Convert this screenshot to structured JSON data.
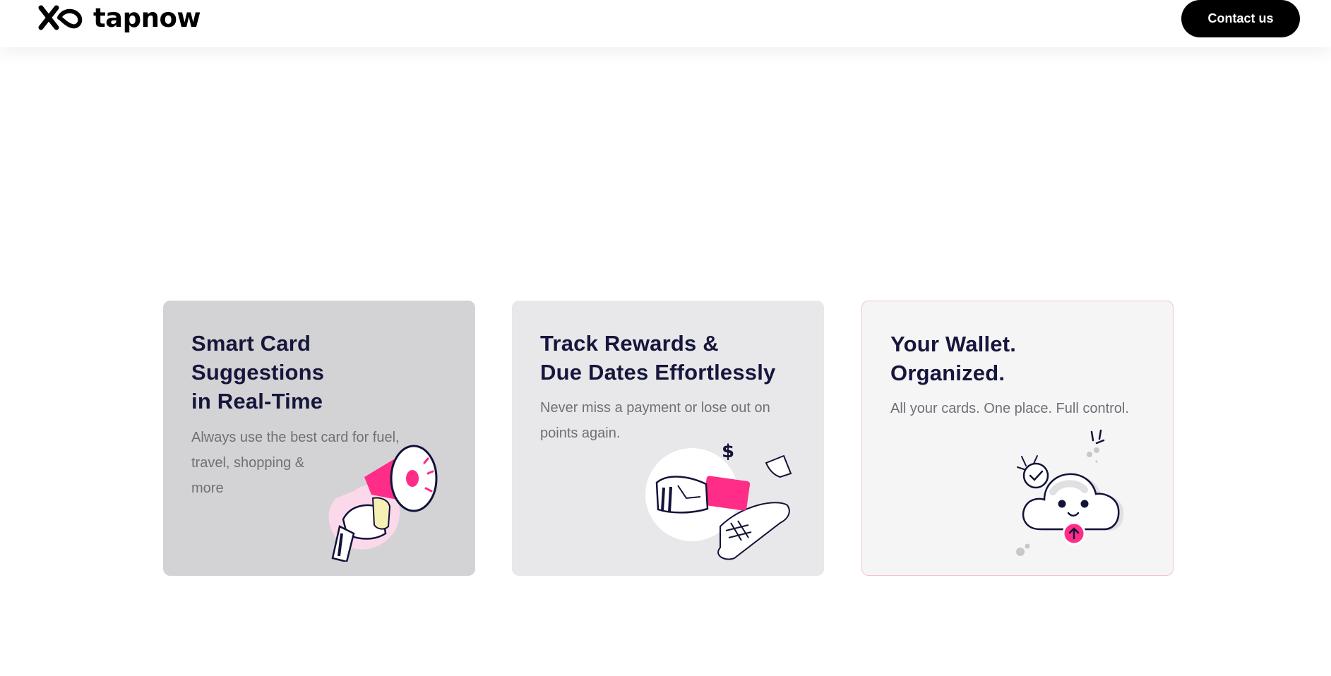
{
  "header": {
    "brand": "tapnow",
    "contact_label": "Contact us"
  },
  "cards": [
    {
      "title": "Smart Card\nSuggestions\nin Real-Time",
      "description": "Always use the best card for fuel,\ntravel, shopping &\nmore",
      "illustration": "megaphone-hand-illustration"
    },
    {
      "title": "Track Rewards &\nDue Dates Effortlessly",
      "description": "Never miss a payment or lose out on\npoints again.",
      "illustration": "card-payment-receipt-illustration"
    },
    {
      "title": "Your Wallet.\nOrganized.",
      "description": "All your cards. One place. Full control.",
      "illustration": "cloud-upload-illustration"
    }
  ],
  "colors": {
    "accent": "#ff2d87",
    "button": "#000000",
    "heading": "#16163c",
    "body_text": "#6f6f78",
    "card_1_bg": "#d3d3d5",
    "card_2_bg": "#e8e8ea",
    "card_3_bg": "#f5f5f6",
    "card_3_border": "#f3c2d4"
  }
}
